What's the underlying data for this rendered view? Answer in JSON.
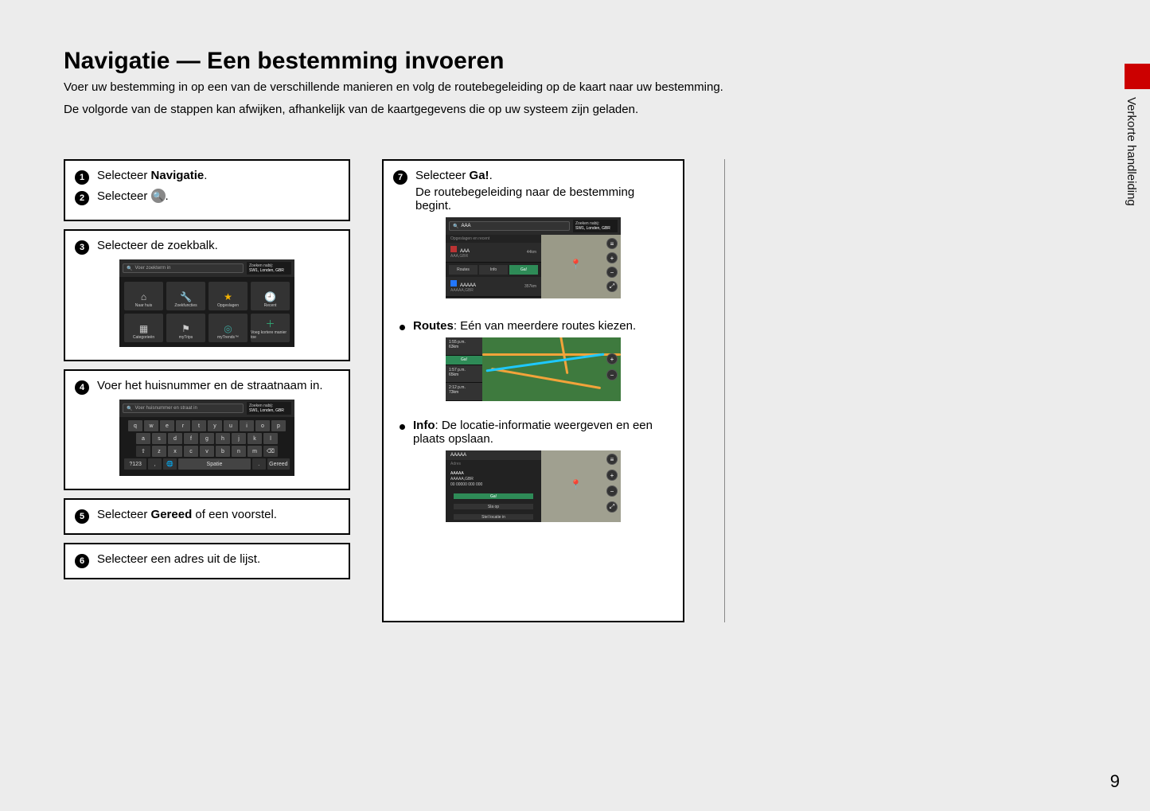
{
  "page_number": "9",
  "side_tab": "Verkorte handleiding",
  "title": "Navigatie — Een bestemming invoeren",
  "intro1": "Voer uw bestemming in op een van de verschillende manieren en volg de routebegeleiding op de kaart naar uw bestemming.",
  "intro2": "De volgorde van de stappen kan afwijken, afhankelijk van de kaartgegevens die op uw systeem zijn geladen.",
  "step1_pre": "Selecteer ",
  "step1_b": "Navigatie",
  "step1_post": ".",
  "step2_pre": "Selecteer ",
  "step2_post": ".",
  "step3": "Selecteer de zoekbalk.",
  "step4": "Voer het huisnummer en de straatnaam in.",
  "step5_pre": "Selecteer ",
  "step5_b": "Gereed",
  "step5_post": " of een voorstel.",
  "step6": "Selecteer een adres uit de lijst.",
  "step7_pre": "Selecteer ",
  "step7_b": "Ga!",
  "step7_post": ".",
  "step7_line2": "De routebegeleiding naar de bestemming begint.",
  "bullet_routes_b": "Routes",
  "bullet_routes_t": ": Eén van meerdere routes kiezen.",
  "bullet_info_b": "Info",
  "bullet_info_t": ": De locatie-informatie weergeven en een plaats opslaan.",
  "screens": {
    "search": {
      "placeholder": "Voer zoekterm in",
      "near_label": "Zoeken nabij:",
      "near_value": "SW1, Londen, GBR",
      "tiles": [
        "Naar huis",
        "Zoekfuncties",
        "Opgeslagen",
        "Recent",
        "Categorieën",
        "myTrips",
        "myTrends™",
        "Voeg kortere manier toe"
      ]
    },
    "keyboard": {
      "placeholder": "Voer huisnummer en straat in",
      "near_label": "Zoeken nabij:",
      "near_value": "SW1, Londen, GBR",
      "rows": [
        [
          "q",
          "w",
          "e",
          "r",
          "t",
          "y",
          "u",
          "i",
          "o",
          "p"
        ],
        [
          "a",
          "s",
          "d",
          "f",
          "g",
          "h",
          "j",
          "k",
          "l"
        ],
        [
          "⇧",
          "z",
          "x",
          "c",
          "v",
          "b",
          "n",
          "m",
          "⌫"
        ]
      ],
      "bottom": [
        "?123",
        ",",
        "🌐",
        "Spatie",
        ".",
        "Gereed"
      ]
    },
    "go": {
      "query": "AAA",
      "near_label": "Zoeken nabij:",
      "near_value": "SW1, Londen, GBR",
      "section": "Opgeslagen en recent",
      "r1_name": "AAA",
      "r1_sub": "AAA,GBR",
      "r1_dist": "44km",
      "r2_name": "AAAAA",
      "r2_sub": "AAAAA,GBR",
      "r2_dist": "357km",
      "btns": [
        "Routes",
        "Info",
        "Ga!"
      ]
    },
    "routes": {
      "times": [
        {
          "t": "1:55 p.m.",
          "d": "63km"
        },
        {
          "t": "1:57 p.m.",
          "d": "65km"
        },
        {
          "t": "2:12 p.m.",
          "d": "73km"
        }
      ],
      "go": "Ga!"
    },
    "info": {
      "title": "AAAAA",
      "sub": "Adres",
      "l1": "AAAAA",
      "l2": "AAAAA,GBR",
      "l3": "00 00000 000 000",
      "btns": [
        "Ga!",
        "Sla op",
        "Stel locatie in"
      ]
    }
  }
}
